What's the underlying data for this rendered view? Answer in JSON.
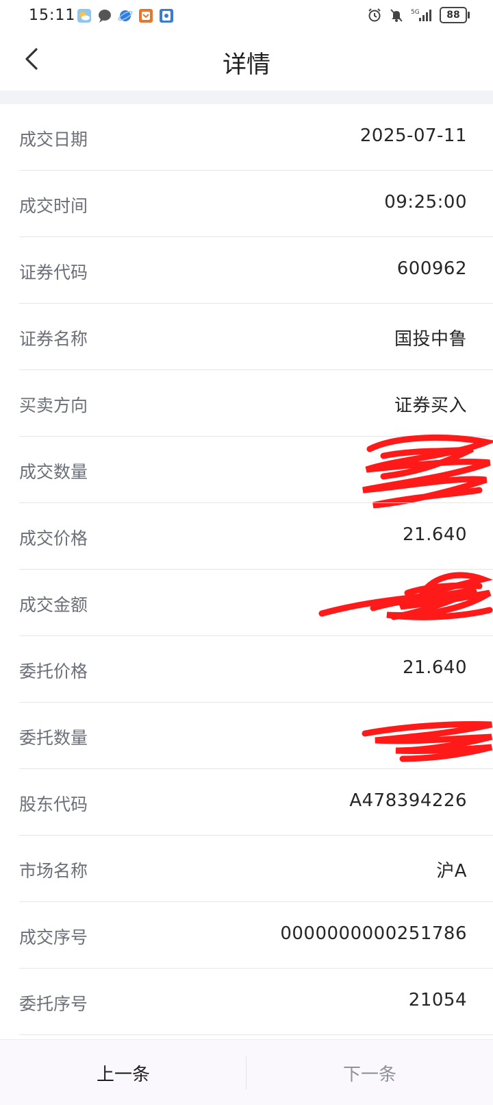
{
  "status_bar": {
    "time": "15:11",
    "battery": "88",
    "left_icons": [
      "weather-icon",
      "message-icon",
      "browser-icon",
      "app-icon",
      "wallet-icon"
    ],
    "right_icons": [
      "alarm-icon",
      "mute-icon",
      "signal-5g-icon",
      "battery-icon"
    ]
  },
  "header": {
    "title": "详情",
    "back_icon": "chevron-left-icon"
  },
  "rows": [
    {
      "label": "成交日期",
      "value": "2025-07-11"
    },
    {
      "label": "成交时间",
      "value": "09:25:00"
    },
    {
      "label": "证券代码",
      "value": "600962"
    },
    {
      "label": "证券名称",
      "value": "国投中鲁"
    },
    {
      "label": "买卖方向",
      "value": "证券买入"
    },
    {
      "label": "成交数量",
      "value": ""
    },
    {
      "label": "成交价格",
      "value": "21.640"
    },
    {
      "label": "成交金额",
      "value": ""
    },
    {
      "label": "委托价格",
      "value": "21.640"
    },
    {
      "label": "委托数量",
      "value": ""
    },
    {
      "label": "股东代码",
      "value": "A478394226"
    },
    {
      "label": "市场名称",
      "value": "沪A"
    },
    {
      "label": "成交序号",
      "value": "0000000000251786"
    },
    {
      "label": "委托序号",
      "value": "21054"
    }
  ],
  "bottom_bar": {
    "prev_label": "上一条",
    "next_label": "下一条"
  },
  "colors": {
    "redaction": "#ff1a1a",
    "label": "#6b6f78",
    "value": "#262626",
    "band": "#f1f3f7"
  }
}
